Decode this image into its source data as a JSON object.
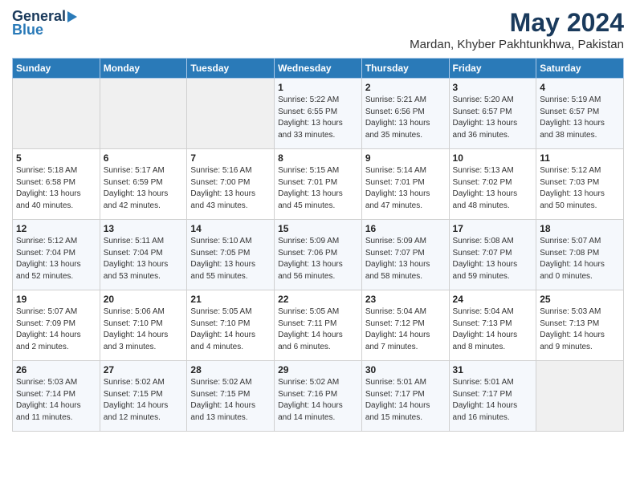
{
  "header": {
    "logo_general": "General",
    "logo_blue": "Blue",
    "title": "May 2024",
    "subtitle": "Mardan, Khyber Pakhtunkhwa, Pakistan"
  },
  "days_of_week": [
    "Sunday",
    "Monday",
    "Tuesday",
    "Wednesday",
    "Thursday",
    "Friday",
    "Saturday"
  ],
  "weeks": [
    [
      {
        "day": "",
        "content": ""
      },
      {
        "day": "",
        "content": ""
      },
      {
        "day": "",
        "content": ""
      },
      {
        "day": "1",
        "content": "Sunrise: 5:22 AM\nSunset: 6:55 PM\nDaylight: 13 hours and 33 minutes."
      },
      {
        "day": "2",
        "content": "Sunrise: 5:21 AM\nSunset: 6:56 PM\nDaylight: 13 hours and 35 minutes."
      },
      {
        "day": "3",
        "content": "Sunrise: 5:20 AM\nSunset: 6:57 PM\nDaylight: 13 hours and 36 minutes."
      },
      {
        "day": "4",
        "content": "Sunrise: 5:19 AM\nSunset: 6:57 PM\nDaylight: 13 hours and 38 minutes."
      }
    ],
    [
      {
        "day": "5",
        "content": "Sunrise: 5:18 AM\nSunset: 6:58 PM\nDaylight: 13 hours and 40 minutes."
      },
      {
        "day": "6",
        "content": "Sunrise: 5:17 AM\nSunset: 6:59 PM\nDaylight: 13 hours and 42 minutes."
      },
      {
        "day": "7",
        "content": "Sunrise: 5:16 AM\nSunset: 7:00 PM\nDaylight: 13 hours and 43 minutes."
      },
      {
        "day": "8",
        "content": "Sunrise: 5:15 AM\nSunset: 7:01 PM\nDaylight: 13 hours and 45 minutes."
      },
      {
        "day": "9",
        "content": "Sunrise: 5:14 AM\nSunset: 7:01 PM\nDaylight: 13 hours and 47 minutes."
      },
      {
        "day": "10",
        "content": "Sunrise: 5:13 AM\nSunset: 7:02 PM\nDaylight: 13 hours and 48 minutes."
      },
      {
        "day": "11",
        "content": "Sunrise: 5:12 AM\nSunset: 7:03 PM\nDaylight: 13 hours and 50 minutes."
      }
    ],
    [
      {
        "day": "12",
        "content": "Sunrise: 5:12 AM\nSunset: 7:04 PM\nDaylight: 13 hours and 52 minutes."
      },
      {
        "day": "13",
        "content": "Sunrise: 5:11 AM\nSunset: 7:04 PM\nDaylight: 13 hours and 53 minutes."
      },
      {
        "day": "14",
        "content": "Sunrise: 5:10 AM\nSunset: 7:05 PM\nDaylight: 13 hours and 55 minutes."
      },
      {
        "day": "15",
        "content": "Sunrise: 5:09 AM\nSunset: 7:06 PM\nDaylight: 13 hours and 56 minutes."
      },
      {
        "day": "16",
        "content": "Sunrise: 5:09 AM\nSunset: 7:07 PM\nDaylight: 13 hours and 58 minutes."
      },
      {
        "day": "17",
        "content": "Sunrise: 5:08 AM\nSunset: 7:07 PM\nDaylight: 13 hours and 59 minutes."
      },
      {
        "day": "18",
        "content": "Sunrise: 5:07 AM\nSunset: 7:08 PM\nDaylight: 14 hours and 0 minutes."
      }
    ],
    [
      {
        "day": "19",
        "content": "Sunrise: 5:07 AM\nSunset: 7:09 PM\nDaylight: 14 hours and 2 minutes."
      },
      {
        "day": "20",
        "content": "Sunrise: 5:06 AM\nSunset: 7:10 PM\nDaylight: 14 hours and 3 minutes."
      },
      {
        "day": "21",
        "content": "Sunrise: 5:05 AM\nSunset: 7:10 PM\nDaylight: 14 hours and 4 minutes."
      },
      {
        "day": "22",
        "content": "Sunrise: 5:05 AM\nSunset: 7:11 PM\nDaylight: 14 hours and 6 minutes."
      },
      {
        "day": "23",
        "content": "Sunrise: 5:04 AM\nSunset: 7:12 PM\nDaylight: 14 hours and 7 minutes."
      },
      {
        "day": "24",
        "content": "Sunrise: 5:04 AM\nSunset: 7:13 PM\nDaylight: 14 hours and 8 minutes."
      },
      {
        "day": "25",
        "content": "Sunrise: 5:03 AM\nSunset: 7:13 PM\nDaylight: 14 hours and 9 minutes."
      }
    ],
    [
      {
        "day": "26",
        "content": "Sunrise: 5:03 AM\nSunset: 7:14 PM\nDaylight: 14 hours and 11 minutes."
      },
      {
        "day": "27",
        "content": "Sunrise: 5:02 AM\nSunset: 7:15 PM\nDaylight: 14 hours and 12 minutes."
      },
      {
        "day": "28",
        "content": "Sunrise: 5:02 AM\nSunset: 7:15 PM\nDaylight: 14 hours and 13 minutes."
      },
      {
        "day": "29",
        "content": "Sunrise: 5:02 AM\nSunset: 7:16 PM\nDaylight: 14 hours and 14 minutes."
      },
      {
        "day": "30",
        "content": "Sunrise: 5:01 AM\nSunset: 7:17 PM\nDaylight: 14 hours and 15 minutes."
      },
      {
        "day": "31",
        "content": "Sunrise: 5:01 AM\nSunset: 7:17 PM\nDaylight: 14 hours and 16 minutes."
      },
      {
        "day": "",
        "content": ""
      }
    ]
  ]
}
